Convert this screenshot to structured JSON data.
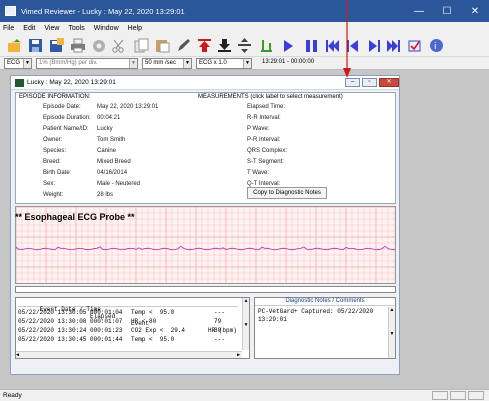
{
  "window": {
    "title": "Vimed Reviewer - Lucky : May 22, 2020 13:29:01",
    "minimize": "—",
    "maximize": "☐",
    "close": "✕"
  },
  "menu": [
    {
      "label": "File",
      "accel": "F"
    },
    {
      "label": "Edit",
      "accel": "E"
    },
    {
      "label": "View",
      "accel": "V"
    },
    {
      "label": "Tools",
      "accel": "T"
    },
    {
      "label": "Window",
      "accel": "W"
    },
    {
      "label": "Help",
      "accel": "H"
    }
  ],
  "options": {
    "channel": "ECG",
    "scale": "1% (Bmm/Hg) per div.",
    "speed": "50 mm /sec",
    "gain": "ECG x 1.0",
    "timecode": "13:29:01 - 00:00:00"
  },
  "child": {
    "title": "Lucky : May 22, 2020 13:29:01",
    "minimize": "–",
    "maximize": "▫",
    "close": "✕"
  },
  "episode": {
    "header": "EPISODE INFORMATION:",
    "fields": [
      {
        "label": "Episode Date:",
        "value": "May 22, 2020 13:29:01"
      },
      {
        "label": "Episode Duration:",
        "value": "00:04:21"
      },
      {
        "label": "Patient Name/ID:",
        "value": "Lucky"
      },
      {
        "label": "Owner:",
        "value": "Tom Smith"
      },
      {
        "label": "Species:",
        "value": "Canine"
      },
      {
        "label": "Breed:",
        "value": "Mixed Breed"
      },
      {
        "label": "Birth Date:",
        "value": "04/16/2014"
      },
      {
        "label": "Sex:",
        "value": "Male - Neutered"
      },
      {
        "label": "Weight:",
        "value": "28 lbs"
      }
    ]
  },
  "measurements": {
    "header": "MEASUREMENTS (click label to select measurement)",
    "fields": [
      "Elapsed Time:",
      "R-R Interval:",
      "P Wave:",
      "P-R Interval:",
      "QRS Complex:",
      "S-T Segment:",
      "T Wave:",
      "Q-T Interval:"
    ],
    "copy_button": "Copy to Diagnostic Notes"
  },
  "ecg": {
    "probe_label": "** Esophageal ECG Probe **",
    "grid_color": "#f4a7a7",
    "trace_color": "#c025b5"
  },
  "events": {
    "headers": [
      "Event Date / Time",
      "Elapsed",
      "Event",
      "HR (bpm)"
    ],
    "rows": [
      [
        "05/22/2020 13:30:05",
        "000:01:04",
        "Temp <  95.0",
        "---"
      ],
      [
        "05/22/2020 13:30:08",
        "000:01:07",
        "HR < 80",
        "79"
      ],
      [
        "05/22/2020 13:30:24",
        "000:01:23",
        "CO2 Exp <  29.4",
        "80"
      ],
      [
        "05/22/2020 13:30:45",
        "000:01:44",
        "Temp <  95.0",
        "---"
      ]
    ]
  },
  "notes": {
    "header": "Diagnostic Notes / Comments",
    "text": "PC-VetGard+ Captured: 05/22/2020 13:29:01"
  },
  "status": {
    "text": "Ready"
  },
  "colors": {
    "accent_blue": "#2b579a",
    "play_blue": "#3b3fd8",
    "record_red": "#d01818"
  }
}
